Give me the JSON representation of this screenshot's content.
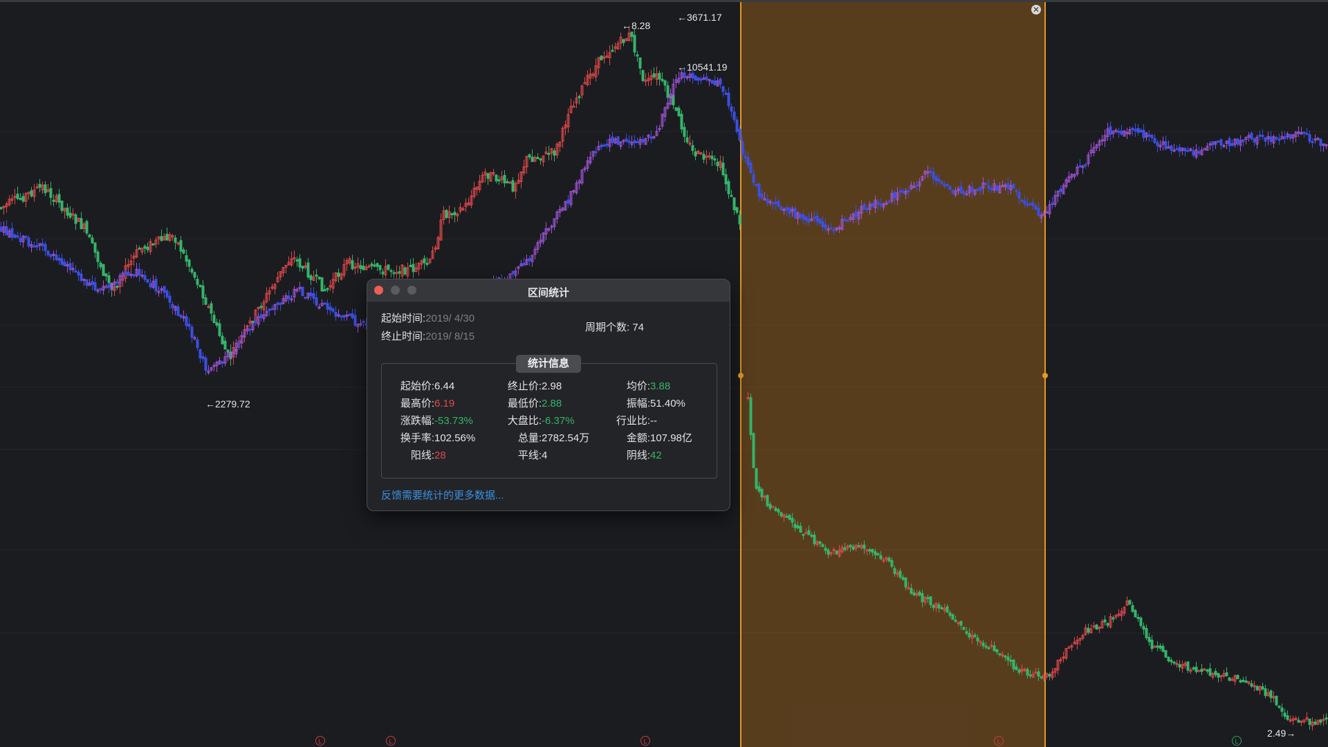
{
  "chart": {
    "colors": {
      "background": "#1b1c20",
      "up": "#e0494a",
      "down": "#35b46a",
      "series_blue": "#3b4fe0",
      "series_purple": "#a055d8",
      "selection_fill": "#8a5a1c",
      "selection_border": "#e39a24"
    },
    "labels": {
      "price_828": "←8.28",
      "price_3671": "←3671.17",
      "price_10541": "←10541.19",
      "price_2279": "←2279.72",
      "price_249": "2.49→"
    },
    "markers": [
      "L",
      "L",
      "L",
      "L",
      "L"
    ],
    "close_symbol": "✕"
  },
  "dialog": {
    "title": "区间统计",
    "start_label": "起始时间:",
    "start_value": "2019/  4/30",
    "end_label": "终止时间:",
    "end_value": "2019/  8/15",
    "periods_label": "周期个数:",
    "periods_value": "74",
    "stats_title": "统计信息",
    "stats": {
      "start_price_label": "起始价:",
      "start_price": "6.44",
      "end_price_label": "终止价:",
      "end_price": "2.98",
      "avg_price_label": "均价:",
      "avg_price": "3.88",
      "high_label": "最高价:",
      "high": "6.19",
      "low_label": "最低价:",
      "low": "2.88",
      "amplitude_label": "振幅:",
      "amplitude": "51.40%",
      "change_label": "涨跌幅:",
      "change": "-53.73%",
      "market_ratio_label": "大盘比:",
      "market_ratio": "-6.37%",
      "industry_ratio_label": "行业比:",
      "industry_ratio": "--",
      "turnover_label": "换手率:",
      "turnover": "102.56%",
      "volume_label": "总量:",
      "volume": "2782.54万",
      "amount_label": "金额:",
      "amount": "107.98亿",
      "up_days_label": "阳线:",
      "up_days": "28",
      "flat_days_label": "平线:",
      "flat_days": "4",
      "down_days_label": "阴线:",
      "down_days": "42"
    },
    "feedback_link": "反馈需要统计的更多数据..."
  }
}
